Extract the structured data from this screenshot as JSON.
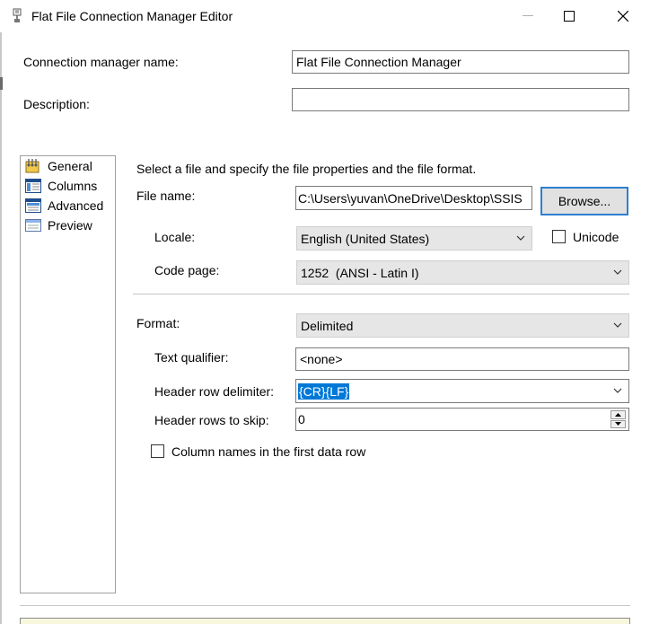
{
  "window": {
    "title": "Flat File Connection Manager Editor",
    "minimize_icon": "minimize-icon",
    "maximize_icon": "maximize-icon",
    "close_icon": "close-icon"
  },
  "header": {
    "connection_name_label": "Connection manager name:",
    "connection_name_value": "Flat File Connection Manager",
    "description_label": "Description:",
    "description_value": ""
  },
  "nav": {
    "items": [
      {
        "label": "General",
        "icon": "general-icon",
        "selected": true
      },
      {
        "label": "Columns",
        "icon": "columns-icon"
      },
      {
        "label": "Advanced",
        "icon": "advanced-icon"
      },
      {
        "label": "Preview",
        "icon": "preview-icon"
      }
    ]
  },
  "general": {
    "instruction": "Select a file and specify the file properties and the file format.",
    "file_name_label": "File name:",
    "file_name_value": "C:\\Users\\yuvan\\OneDrive\\Desktop\\SSIS",
    "browse_label": "Browse...",
    "locale_label": "Locale:",
    "locale_value": "English (United States)",
    "unicode_label": "Unicode",
    "unicode_checked": false,
    "code_page_label": "Code page:",
    "code_page_value": "1252  (ANSI - Latin I)",
    "format_label": "Format:",
    "format_value": "Delimited",
    "text_qualifier_label": "Text qualifier:",
    "text_qualifier_value": "<none>",
    "header_row_delimiter_label": "Header row delimiter:",
    "header_row_delimiter_value": "{CR}{LF}",
    "header_rows_to_skip_label": "Header rows to skip:",
    "header_rows_to_skip_value": "0",
    "column_names_label": "Column names in the first data row",
    "column_names_checked": false
  },
  "colors": {
    "accent": "#2e7fd1",
    "selection": "#0078d7",
    "combo_bg": "#e6e6e6",
    "nav_border": "#a0a0a0"
  }
}
